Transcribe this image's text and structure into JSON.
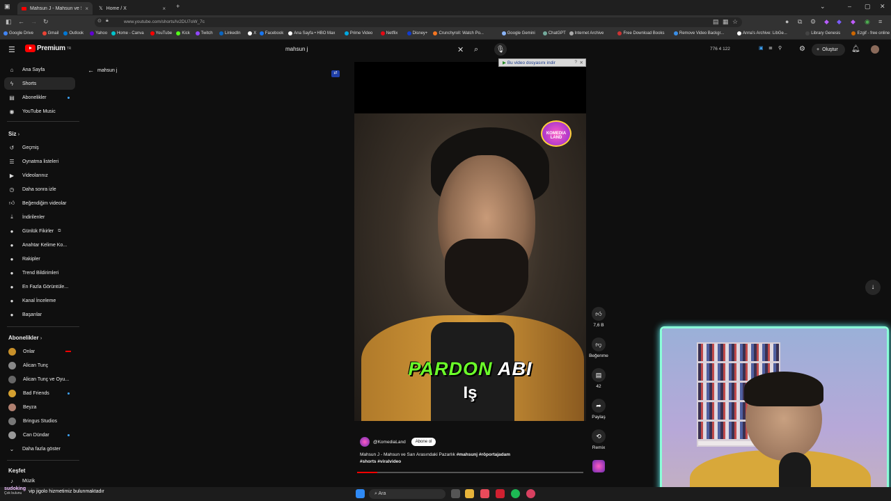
{
  "browser": {
    "tabs": [
      {
        "label": "Mahsun J - Mahsun ve Sarı",
        "active": true
      },
      {
        "label": "Home / X",
        "active": false
      }
    ],
    "url": "www.youtube.com/shorts/Iv2DU7oW_7c",
    "bookmarks": [
      "Google Drive",
      "Gmail",
      "Outlook",
      "Yahoo",
      "Home - Canva",
      "YouTube",
      "Kick",
      "Twitch",
      "LinkedIn",
      "X",
      "Facebook",
      "Ana Sayfa • HBO Max",
      "Prime Video",
      "Netflix",
      "Disney+",
      "Crunchyroll: Watch Po...",
      "Google Gemini",
      "ChatGPT",
      "Internet Archive",
      "Free Download Books",
      "Remove Video Backgr...",
      "Anna's Archive: LibGe...",
      "Library Genesis",
      "Ezgif - free online ani..."
    ]
  },
  "header": {
    "logo_text": "Premium",
    "logo_sup": "TR",
    "search_value": "mahsun j",
    "stats": "776   4   122",
    "create_label": "Oluştur"
  },
  "sidebar": {
    "main": [
      {
        "label": "Ana Sayfa",
        "icon": "home-icon"
      },
      {
        "label": "Shorts",
        "icon": "shorts-icon",
        "active": true
      },
      {
        "label": "Abonelikler",
        "icon": "subscriptions-icon"
      },
      {
        "label": "YouTube Music",
        "icon": "music-icon"
      }
    ],
    "you_header": "Siz",
    "you": [
      {
        "label": "Geçmiş",
        "icon": "history-icon"
      },
      {
        "label": "Oynatma listeleri",
        "icon": "playlist-icon"
      },
      {
        "label": "Videolarınız",
        "icon": "your-videos-icon"
      },
      {
        "label": "Daha sonra izle",
        "icon": "watch-later-icon"
      },
      {
        "label": "Beğendiğim videolar",
        "icon": "liked-icon"
      },
      {
        "label": "İndirilenler",
        "icon": "download-icon"
      },
      {
        "label": "Günlük Fikirler",
        "icon": "ideas-icon"
      },
      {
        "label": "Anahtar Kelime Ko...",
        "icon": "keyword-icon"
      },
      {
        "label": "Rakipler",
        "icon": "competitors-icon"
      },
      {
        "label": "Trend Bildirimleri",
        "icon": "trend-icon"
      },
      {
        "label": "En Fazla Görüntüle...",
        "icon": "most-viewed-icon"
      },
      {
        "label": "Kanal İnceleme",
        "icon": "channel-review-icon"
      },
      {
        "label": "Başarılar",
        "icon": "achievements-icon"
      }
    ],
    "subs_header": "Abonelikler",
    "subs": [
      {
        "label": "Onlar",
        "color": "#c8902a"
      },
      {
        "label": "Alican Tunç",
        "color": "#888888"
      },
      {
        "label": "Alican Tunç ve Oyu...",
        "color": "#666666"
      },
      {
        "label": "Bad Friends",
        "color": "#d4a030"
      },
      {
        "label": "Beyza",
        "color": "#b08070"
      },
      {
        "label": "Bringus Studios",
        "color": "#777777"
      },
      {
        "label": "Can Dündar",
        "color": "#999999"
      },
      {
        "label": "Daha fazla göster",
        "icon": "chevron-down-icon"
      }
    ],
    "explore_header": "Keşfet",
    "explore_first": "Müzik"
  },
  "shorts": {
    "back_label": "mahsun j",
    "download_bar": "Bu video dosyasını indir",
    "subtitle_green": "PARDON",
    "subtitle_white": "ABI",
    "subtitle_line2": "Iş",
    "logo_badge": "KOMEDIA LAND",
    "channel": "@KomediaLand",
    "subscribe_label": "Abone ol",
    "caption_plain": "Mahsun J - Mahsun ve Sarı Arasındaki Pazarlık ",
    "caption_tags": "#mahsunj #röportajadam #shorts #viralvideo",
    "progress": 0.09,
    "actions": [
      {
        "label": "7,6 B",
        "icon": "like-icon"
      },
      {
        "label": "Beğenme",
        "icon": "dislike-icon"
      },
      {
        "label": "42",
        "icon": "comment-icon"
      },
      {
        "label": "Paylaş",
        "icon": "share-icon"
      },
      {
        "label": "Remix",
        "icon": "remix-icon"
      }
    ]
  },
  "chat": {
    "user": "sudoking",
    "user_sub": "Çok bulunu",
    "message": "vip jigolo hizmetimiz bulunmaktadır"
  },
  "taskbar": {
    "search_label": "Ara"
  }
}
